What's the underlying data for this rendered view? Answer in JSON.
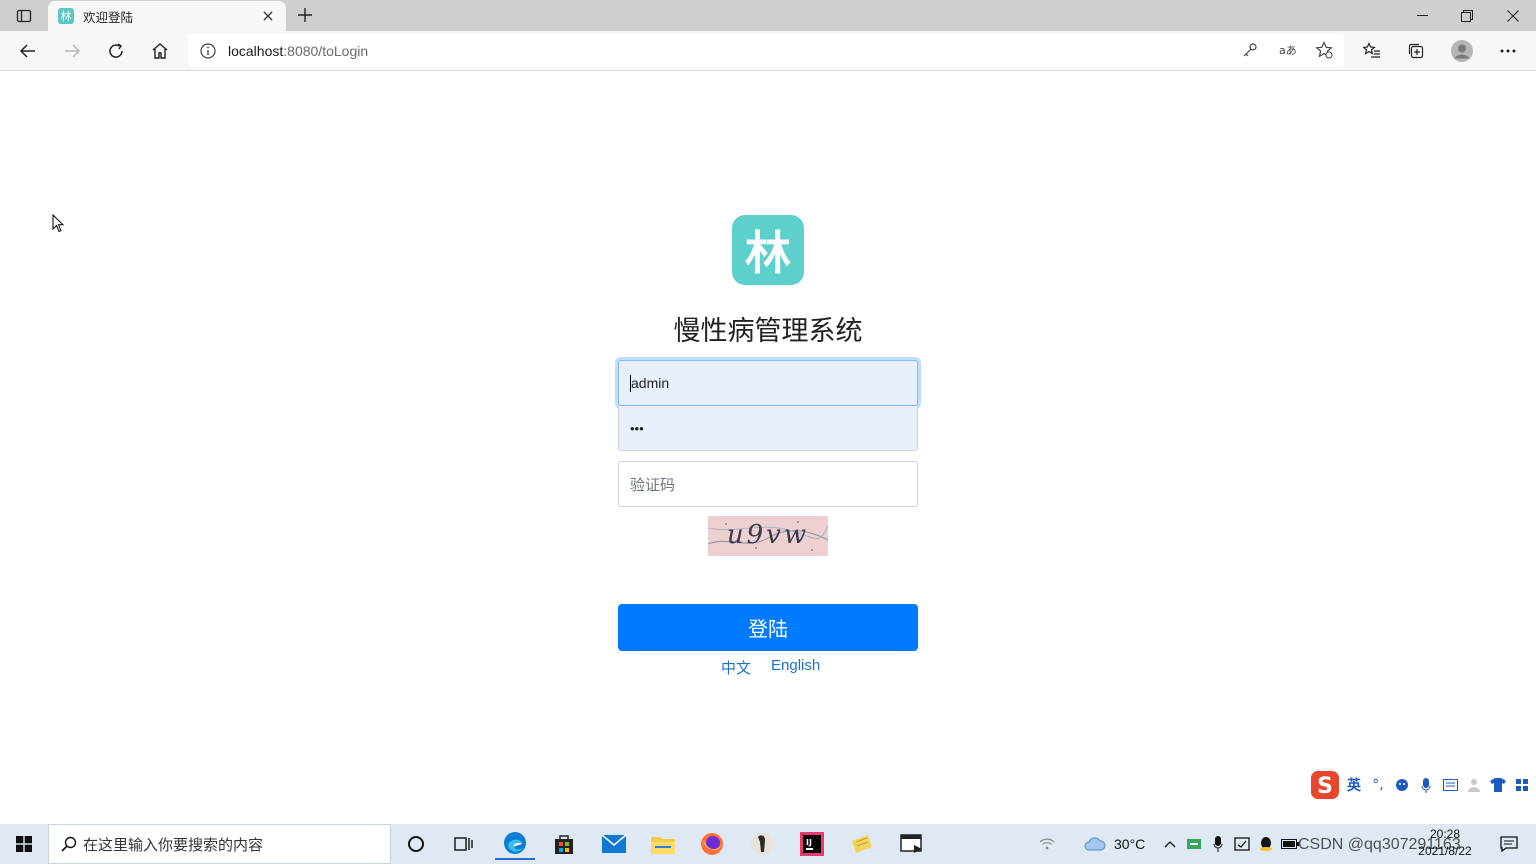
{
  "browser": {
    "tab_title": "欢迎登陆",
    "tab_favicon_text": "林",
    "url_host": "localhost",
    "url_path": ":8080/toLogin"
  },
  "login": {
    "logo_text": "林",
    "title": "慢性病管理系统",
    "username_value": "admin",
    "password_value": "•••",
    "captcha_placeholder": "验证码",
    "captcha_image_text": "u9vw",
    "submit_label": "登陆",
    "lang_zh": "中文",
    "lang_en": "English"
  },
  "ime": {
    "mode": "英"
  },
  "taskbar": {
    "search_placeholder": "在这里输入你要搜索的内容",
    "temperature": "30°C",
    "time": "20:28",
    "date": "2021/8/22",
    "watermark": "CSDN @qq307291163"
  },
  "colors": {
    "brand_teal": "#5ed0cc",
    "primary_blue": "#007bff",
    "link_blue": "#1a73c8"
  }
}
